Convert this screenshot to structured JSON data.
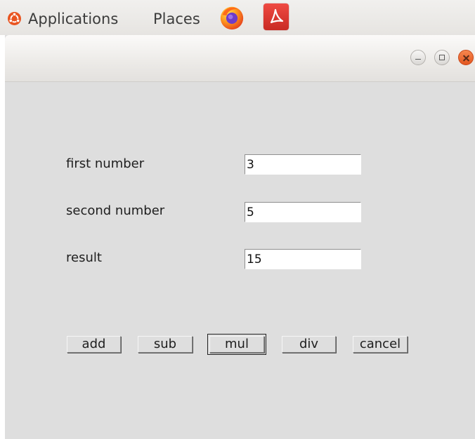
{
  "top_panel": {
    "applications_label": "Applications",
    "places_label": "Places"
  },
  "window": {
    "title": ""
  },
  "form": {
    "first_number": {
      "label": "first number",
      "value": "3"
    },
    "second_number": {
      "label": "second number",
      "value": "5"
    },
    "result": {
      "label": "result",
      "value": "15"
    }
  },
  "buttons": {
    "add": "add",
    "sub": "sub",
    "mul": "mul",
    "div": "div",
    "cancel": "cancel"
  },
  "colors": {
    "window_bg": "#dedede",
    "close_button": "#e95420",
    "pdf_icon": "#dc3a31"
  }
}
